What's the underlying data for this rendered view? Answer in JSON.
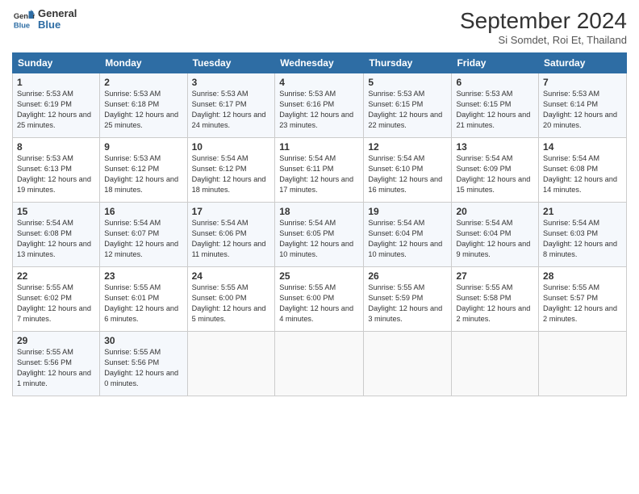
{
  "header": {
    "logo_line1": "General",
    "logo_line2": "Blue",
    "month": "September 2024",
    "location": "Si Somdet, Roi Et, Thailand"
  },
  "weekdays": [
    "Sunday",
    "Monday",
    "Tuesday",
    "Wednesday",
    "Thursday",
    "Friday",
    "Saturday"
  ],
  "weeks": [
    [
      {
        "day": "1",
        "sunrise": "5:53 AM",
        "sunset": "6:19 PM",
        "daylight": "12 hours and 25 minutes."
      },
      {
        "day": "2",
        "sunrise": "5:53 AM",
        "sunset": "6:18 PM",
        "daylight": "12 hours and 25 minutes."
      },
      {
        "day": "3",
        "sunrise": "5:53 AM",
        "sunset": "6:17 PM",
        "daylight": "12 hours and 24 minutes."
      },
      {
        "day": "4",
        "sunrise": "5:53 AM",
        "sunset": "6:16 PM",
        "daylight": "12 hours and 23 minutes."
      },
      {
        "day": "5",
        "sunrise": "5:53 AM",
        "sunset": "6:15 PM",
        "daylight": "12 hours and 22 minutes."
      },
      {
        "day": "6",
        "sunrise": "5:53 AM",
        "sunset": "6:15 PM",
        "daylight": "12 hours and 21 minutes."
      },
      {
        "day": "7",
        "sunrise": "5:53 AM",
        "sunset": "6:14 PM",
        "daylight": "12 hours and 20 minutes."
      }
    ],
    [
      {
        "day": "8",
        "sunrise": "5:53 AM",
        "sunset": "6:13 PM",
        "daylight": "12 hours and 19 minutes."
      },
      {
        "day": "9",
        "sunrise": "5:53 AM",
        "sunset": "6:12 PM",
        "daylight": "12 hours and 18 minutes."
      },
      {
        "day": "10",
        "sunrise": "5:54 AM",
        "sunset": "6:12 PM",
        "daylight": "12 hours and 18 minutes."
      },
      {
        "day": "11",
        "sunrise": "5:54 AM",
        "sunset": "6:11 PM",
        "daylight": "12 hours and 17 minutes."
      },
      {
        "day": "12",
        "sunrise": "5:54 AM",
        "sunset": "6:10 PM",
        "daylight": "12 hours and 16 minutes."
      },
      {
        "day": "13",
        "sunrise": "5:54 AM",
        "sunset": "6:09 PM",
        "daylight": "12 hours and 15 minutes."
      },
      {
        "day": "14",
        "sunrise": "5:54 AM",
        "sunset": "6:08 PM",
        "daylight": "12 hours and 14 minutes."
      }
    ],
    [
      {
        "day": "15",
        "sunrise": "5:54 AM",
        "sunset": "6:08 PM",
        "daylight": "12 hours and 13 minutes."
      },
      {
        "day": "16",
        "sunrise": "5:54 AM",
        "sunset": "6:07 PM",
        "daylight": "12 hours and 12 minutes."
      },
      {
        "day": "17",
        "sunrise": "5:54 AM",
        "sunset": "6:06 PM",
        "daylight": "12 hours and 11 minutes."
      },
      {
        "day": "18",
        "sunrise": "5:54 AM",
        "sunset": "6:05 PM",
        "daylight": "12 hours and 10 minutes."
      },
      {
        "day": "19",
        "sunrise": "5:54 AM",
        "sunset": "6:04 PM",
        "daylight": "12 hours and 10 minutes."
      },
      {
        "day": "20",
        "sunrise": "5:54 AM",
        "sunset": "6:04 PM",
        "daylight": "12 hours and 9 minutes."
      },
      {
        "day": "21",
        "sunrise": "5:54 AM",
        "sunset": "6:03 PM",
        "daylight": "12 hours and 8 minutes."
      }
    ],
    [
      {
        "day": "22",
        "sunrise": "5:55 AM",
        "sunset": "6:02 PM",
        "daylight": "12 hours and 7 minutes."
      },
      {
        "day": "23",
        "sunrise": "5:55 AM",
        "sunset": "6:01 PM",
        "daylight": "12 hours and 6 minutes."
      },
      {
        "day": "24",
        "sunrise": "5:55 AM",
        "sunset": "6:00 PM",
        "daylight": "12 hours and 5 minutes."
      },
      {
        "day": "25",
        "sunrise": "5:55 AM",
        "sunset": "6:00 PM",
        "daylight": "12 hours and 4 minutes."
      },
      {
        "day": "26",
        "sunrise": "5:55 AM",
        "sunset": "5:59 PM",
        "daylight": "12 hours and 3 minutes."
      },
      {
        "day": "27",
        "sunrise": "5:55 AM",
        "sunset": "5:58 PM",
        "daylight": "12 hours and 2 minutes."
      },
      {
        "day": "28",
        "sunrise": "5:55 AM",
        "sunset": "5:57 PM",
        "daylight": "12 hours and 2 minutes."
      }
    ],
    [
      {
        "day": "29",
        "sunrise": "5:55 AM",
        "sunset": "5:56 PM",
        "daylight": "12 hours and 1 minute."
      },
      {
        "day": "30",
        "sunrise": "5:55 AM",
        "sunset": "5:56 PM",
        "daylight": "12 hours and 0 minutes."
      },
      null,
      null,
      null,
      null,
      null
    ]
  ]
}
